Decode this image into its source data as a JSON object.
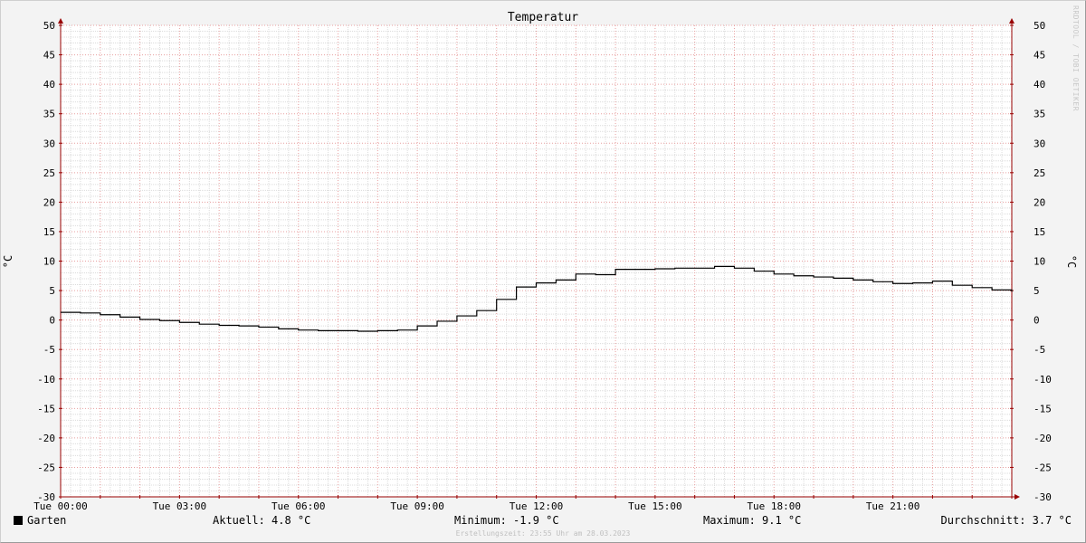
{
  "chart_data": {
    "type": "line",
    "title": "Temperatur",
    "ylabel": "°C",
    "ylabel_right": "°C",
    "ylim": [
      -30,
      50
    ],
    "y_ticks": [
      50,
      45,
      40,
      35,
      30,
      25,
      20,
      15,
      10,
      5,
      0,
      -5,
      -10,
      -15,
      -20,
      -25,
      -30
    ],
    "xlim_hours": [
      0,
      24
    ],
    "x_ticks": [
      {
        "hour": 0,
        "label": "Tue 00:00"
      },
      {
        "hour": 3,
        "label": "Tue 03:00"
      },
      {
        "hour": 6,
        "label": "Tue 06:00"
      },
      {
        "hour": 9,
        "label": "Tue 09:00"
      },
      {
        "hour": 12,
        "label": "Tue 12:00"
      },
      {
        "hour": 15,
        "label": "Tue 15:00"
      },
      {
        "hour": 18,
        "label": "Tue 18:00"
      },
      {
        "hour": 21,
        "label": "Tue 21:00"
      }
    ],
    "grid": true,
    "series": [
      {
        "name": "Garten",
        "color": "#000000",
        "x": [
          0,
          0.5,
          1,
          1.5,
          2,
          2.5,
          3,
          3.5,
          4,
          4.5,
          5,
          5.5,
          6,
          6.5,
          7,
          7.5,
          8,
          8.5,
          9,
          9.5,
          10,
          10.5,
          11,
          11.5,
          12,
          12.5,
          13,
          13.5,
          14,
          14.5,
          15,
          15.5,
          16,
          16.5,
          17,
          17.5,
          18,
          18.5,
          19,
          19.5,
          20,
          20.5,
          21,
          21.5,
          22,
          22.5,
          23,
          23.5,
          24
        ],
        "y": [
          1.3,
          1.2,
          0.9,
          0.5,
          0.1,
          -0.1,
          -0.4,
          -0.7,
          -0.9,
          -1.0,
          -1.2,
          -1.5,
          -1.7,
          -1.8,
          -1.8,
          -1.9,
          -1.8,
          -1.7,
          -1.0,
          -0.2,
          0.7,
          1.6,
          3.5,
          5.6,
          6.3,
          6.8,
          7.8,
          7.7,
          8.6,
          8.6,
          8.7,
          8.8,
          8.8,
          9.1,
          8.8,
          8.3,
          7.8,
          7.5,
          7.3,
          7.1,
          6.8,
          6.5,
          6.2,
          6.3,
          6.6,
          5.9,
          5.5,
          5.1,
          4.8
        ]
      }
    ]
  },
  "legend": {
    "series_name": "Garten",
    "aktuell": "Aktuell: 4.8 °C",
    "minimum": "Minimum: -1.9 °C",
    "maximum": "Maximum: 9.1 °C",
    "durchschnitt": "Durchschnitt: 3.7 °C"
  },
  "footer": "Erstellungszeit: 23:55 Uhr am 28.03.2023",
  "watermark": "RRDTOOL / TOBI OETIKER",
  "colors": {
    "background": "#f3f3f3",
    "plot_background": "#ffffff",
    "major_grid": "#e8a0a0",
    "minor_grid": "#dcdcdc",
    "axis": "#990000",
    "line": "#000000"
  }
}
